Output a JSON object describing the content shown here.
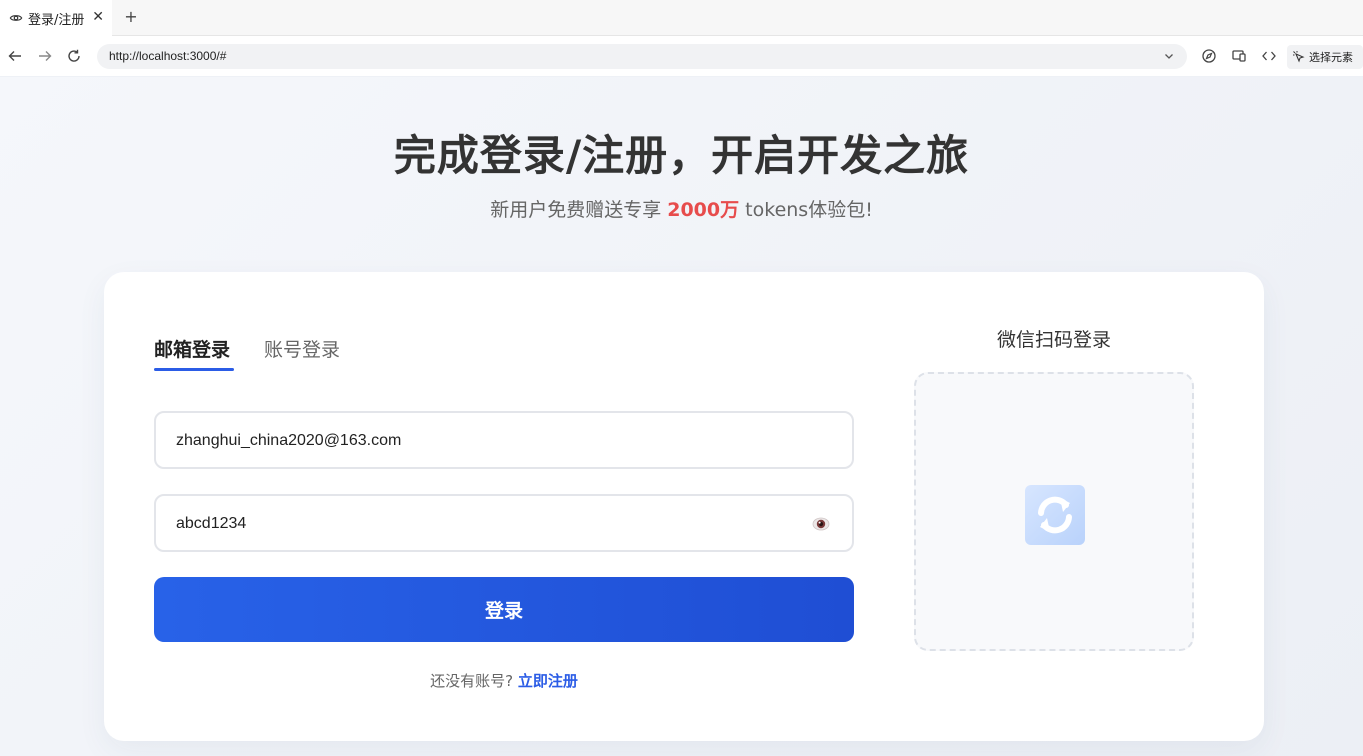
{
  "browser": {
    "tab_title": "登录/注册",
    "tab_close": "✕",
    "new_tab": "+",
    "url": "http://localhost:3000/#",
    "select_element_label": "选择元素"
  },
  "hero": {
    "title": "完成登录/注册，开启开发之旅",
    "subtitle_pre": "新用户免费赠送专享 ",
    "subtitle_highlight": "2000万",
    "subtitle_post": " tokens体验包!"
  },
  "login": {
    "tabs": [
      {
        "label": "邮箱登录",
        "active": true
      },
      {
        "label": "账号登录",
        "active": false
      }
    ],
    "email_value": "zhanghui_china2020@163.com",
    "password_value": "abcd1234",
    "submit_label": "登录",
    "register_prompt": "还没有账号?",
    "register_link": "立即注册"
  },
  "wechat": {
    "title": "微信扫码登录",
    "icon": "refresh-icon"
  },
  "colors": {
    "primary": "#2b5ce6",
    "highlight": "#e74c4c"
  }
}
